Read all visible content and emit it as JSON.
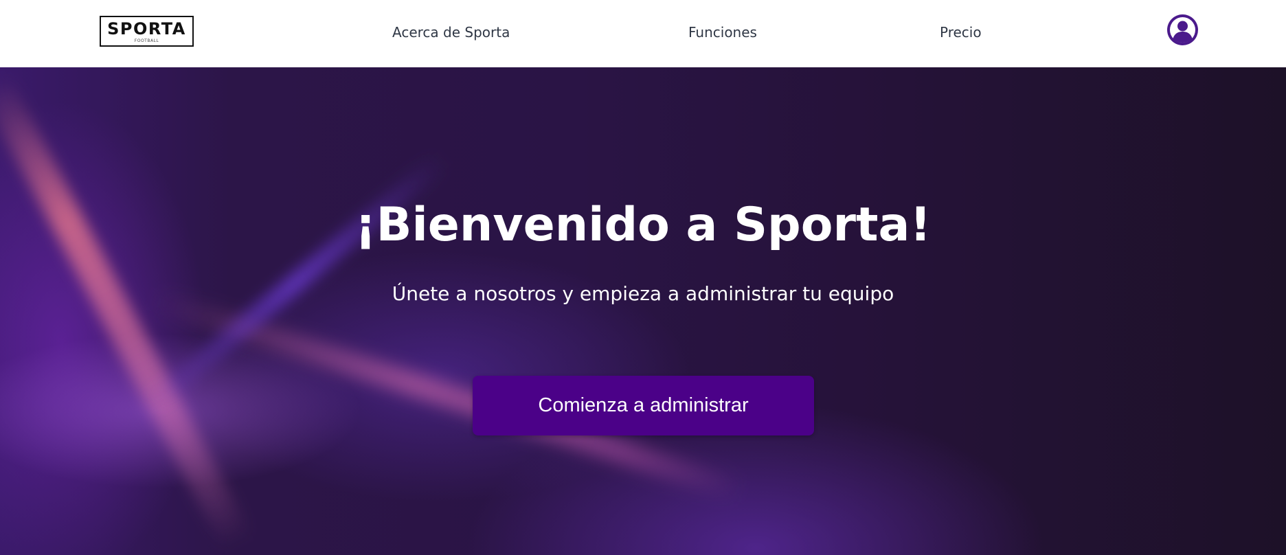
{
  "header": {
    "logo": {
      "name": "SPORTA",
      "tagline": "FOOTBALL"
    },
    "nav": [
      {
        "label": "Acerca de Sporta"
      },
      {
        "label": "Funciones"
      },
      {
        "label": "Precio"
      }
    ],
    "avatar_icon": "user-circle-icon",
    "avatar_color": "#4b1a8c"
  },
  "hero": {
    "title": "¡Bienvenido a Sporta!",
    "subtitle": "Únete a nosotros y empieza a administrar tu equipo",
    "cta_label": "Comienza a administrar",
    "cta_color": "#4b0188"
  },
  "colors": {
    "nav_text": "#2f3745",
    "hero_background": "#2a1445"
  }
}
